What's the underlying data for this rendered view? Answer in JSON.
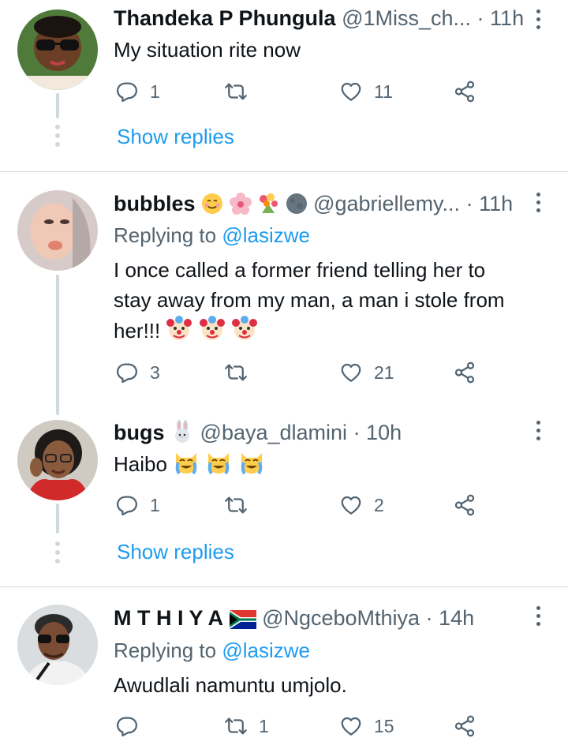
{
  "tweets": [
    {
      "name": "Thandeka P Phungula",
      "handle": "@1Miss_ch...",
      "time": "· 11h",
      "text": "My situation rite now",
      "replies": "1",
      "retweets": "",
      "likes": "11",
      "show_replies": "Show replies"
    },
    {
      "name": "bubbles",
      "handle": "@gabriellemy...",
      "time": "· 11h",
      "replying_label": "Replying to",
      "replying_to": "@lasizwe",
      "text_line1": "I once called a former friend telling her to",
      "text_line2": "stay away from my man, a man i stole from",
      "text_line3": "her!!!",
      "replies": "3",
      "retweets": "",
      "likes": "21"
    },
    {
      "name": "bugs",
      "handle": "@baya_dlamini",
      "time": "· 10h",
      "text": "Haibo",
      "replies": "1",
      "retweets": "",
      "likes": "2",
      "show_replies": "Show replies"
    },
    {
      "name": "M T H I Y A",
      "handle": "@NgceboMthiya",
      "time": "· 14h",
      "replying_label": "Replying to",
      "replying_to": "@lasizwe",
      "text": "Awudlali namuntu umjolo.",
      "replies": "",
      "retweets": "1",
      "likes": "15"
    }
  ],
  "colors": {
    "accent": "#1d9bf0",
    "secondary_text": "#536471",
    "divider": "#cfd9de"
  },
  "icons": [
    "reply-icon",
    "retweet-icon",
    "like-icon",
    "share-icon",
    "more-icon"
  ]
}
